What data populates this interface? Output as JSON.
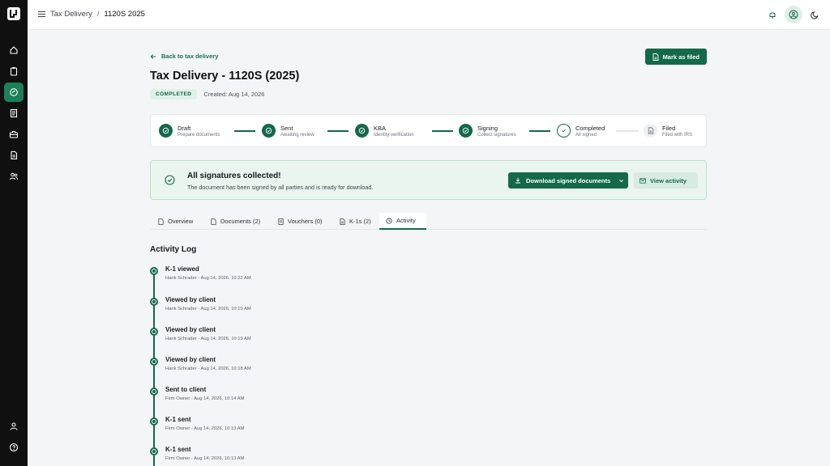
{
  "breadcrumb": {
    "parent": "Tax Delivery",
    "separator": "/",
    "current": "1120S 2025"
  },
  "back_link": "Back to tax delivery",
  "mark_filed_button": "Mark as filed",
  "page_title": "Tax Delivery - 1120S (2025)",
  "status_badge": "COMPLETED",
  "created": "Created: Aug 14, 2026",
  "steps": [
    {
      "title": "Draft",
      "subtitle": "Prepare documents"
    },
    {
      "title": "Sent",
      "subtitle": "Awaiting review"
    },
    {
      "title": "KBA",
      "subtitle": "Identity verification"
    },
    {
      "title": "Signing",
      "subtitle": "Collect signatures"
    },
    {
      "title": "Completed",
      "subtitle": "All signed"
    },
    {
      "title": "Filed",
      "subtitle": "Filed with IRS"
    }
  ],
  "success": {
    "title": "All signatures collected!",
    "description": "The document has been signed by all parties and is ready for download."
  },
  "download_button": "Download signed documents",
  "view_activity_button": "View activity",
  "tabs": [
    {
      "label": "Overview"
    },
    {
      "label": "Documents (2)"
    },
    {
      "label": "Vouchers (0)"
    },
    {
      "label": "K-1s (2)"
    },
    {
      "label": "Activity"
    }
  ],
  "activity_log_title": "Activity Log",
  "activity": [
    {
      "title": "K-1 viewed",
      "meta": "Hank Schrader - Aug 14, 2026, 10:22 AM"
    },
    {
      "title": "Viewed by client",
      "meta": "Hank Schrader - Aug 14, 2026, 10:19 AM"
    },
    {
      "title": "Viewed by client",
      "meta": "Hank Schrader - Aug 14, 2026, 10:19 AM"
    },
    {
      "title": "Viewed by client",
      "meta": "Hank Schrader - Aug 14, 2026, 10:18 AM"
    },
    {
      "title": "Sent to client",
      "meta": "Firm Owner - Aug 14, 2026, 10:14 AM"
    },
    {
      "title": "K-1 sent",
      "meta": "Firm Owner - Aug 14, 2026, 10:13 AM"
    },
    {
      "title": "K-1 sent",
      "meta": "Firm Owner - Aug 14, 2026, 10:13 AM"
    }
  ],
  "colors": {
    "accent": "#14694b",
    "sidebar": "#101010",
    "success_bg": "#eaf5ef"
  }
}
